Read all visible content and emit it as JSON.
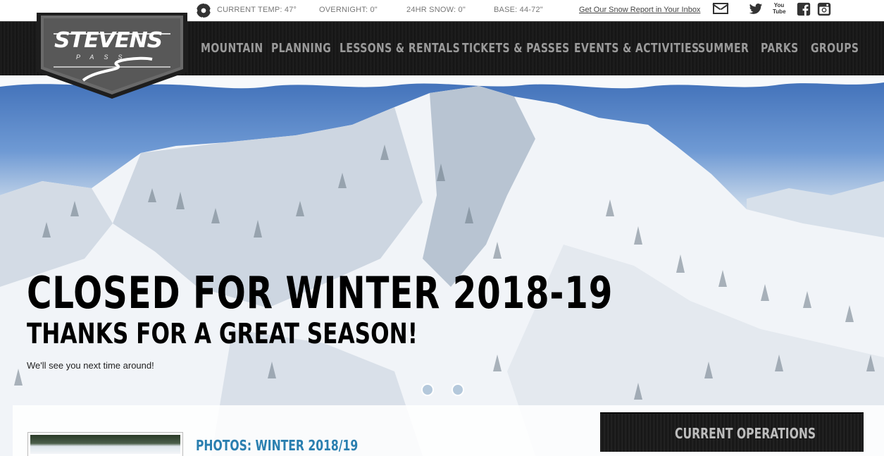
{
  "topbar": {
    "current_temp": "CURRENT TEMP: 47°",
    "overnight": "OVERNIGHT: 0\"",
    "snow_24hr": "24HR SNOW: 0\"",
    "base": "BASE: 44-72\"",
    "snow_report_link": "Get Our Snow Report in Your Inbox"
  },
  "logo": {
    "name": "STEVENS",
    "sub": "PASS"
  },
  "nav": {
    "items": [
      {
        "label": "MOUNTAIN"
      },
      {
        "label": "PLANNING"
      },
      {
        "label": "LESSONS & RENTALS"
      },
      {
        "label": "TICKETS & PASSES"
      },
      {
        "label": "EVENTS & ACTIVITIES"
      },
      {
        "label": "SUMMER"
      },
      {
        "label": "PARKS"
      },
      {
        "label": "GROUPS"
      }
    ]
  },
  "hero": {
    "headline": "CLOSED FOR WINTER 2018-19",
    "subheadline": "THANKS FOR A GREAT SEASON!",
    "tagline": "We'll see you next time around!"
  },
  "content": {
    "photos_title": "PHOTOS: WINTER 2018/19",
    "operations_label": "CURRENT OPERATIONS"
  },
  "social": {
    "icons": [
      "mail-icon",
      "twitter-icon",
      "youtube-icon",
      "facebook-icon",
      "instagram-icon"
    ],
    "youtube_text": "You Tube"
  },
  "colors": {
    "nav_bg": "#1a1a1a",
    "nav_text": "#9a9a9a",
    "link_blue": "#2a7fb0",
    "logo_badge": "#5c5c5c"
  }
}
